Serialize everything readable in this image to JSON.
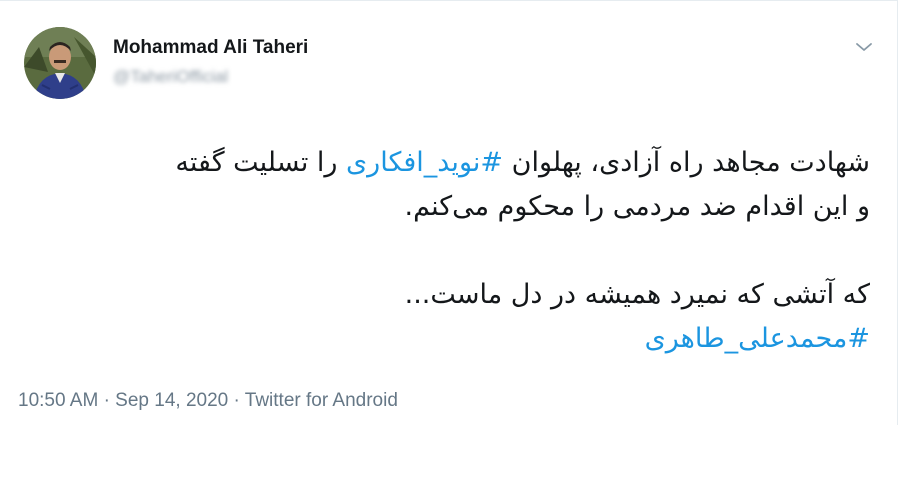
{
  "tweet": {
    "author_name": "Mohammad Ali Taheri",
    "author_handle": "@TaheriOfficial",
    "line1_a": "شهادت مجاهد راه آزادی، پهلوان ",
    "hashtag1": "#نوید_افکاری",
    "line1_b": " را تسلیت گفته",
    "line2": "و این اقدام ضد مردمی را محکوم می‌کنم.",
    "line3": "که آتشی که نمیرد همیشه در دل ماست...",
    "hashtag2": "#محمدعلی_طاهری",
    "time": "10:50 AM",
    "separator": "·",
    "date": "Sep 14, 2020",
    "source": "Twitter for Android"
  },
  "icons": {
    "menu": "chevron-down-icon"
  },
  "colors": {
    "hashtag": "#1b95e0",
    "text": "#14171a",
    "meta": "#657786"
  }
}
